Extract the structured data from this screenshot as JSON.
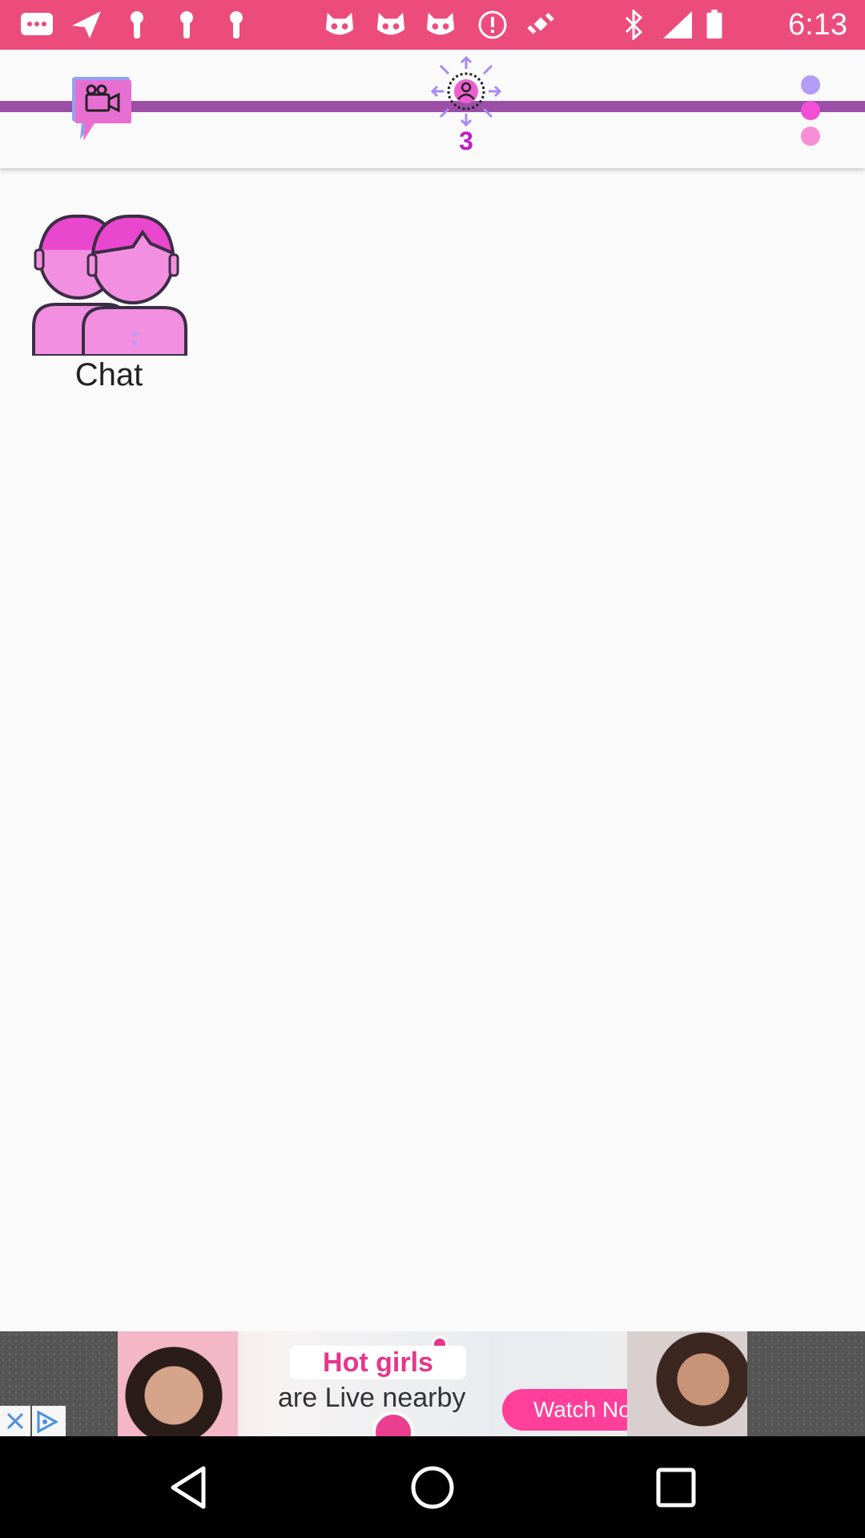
{
  "status_bar": {
    "time": "6:13",
    "background_color": "#ec4c7c",
    "icons": [
      "messages-icon",
      "send-icon",
      "key-icon",
      "key-icon",
      "key-icon",
      "cat-face-icon",
      "cat-face-icon",
      "cat-face-icon",
      "alert-icon",
      "fake-gps-icon",
      "bluetooth-icon",
      "signal-icon",
      "battery-icon"
    ]
  },
  "app_bar": {
    "accent_stripe_color": "#9b4fa6",
    "nearby_count": "3",
    "nearby_count_color": "#c21acb"
  },
  "content": {
    "tiles": [
      {
        "label": "Chat",
        "icon": "two-people-icon"
      }
    ]
  },
  "ad_banner": {
    "headline": "Hot girls",
    "subline": "are Live nearby",
    "cta": "Watch Now"
  }
}
